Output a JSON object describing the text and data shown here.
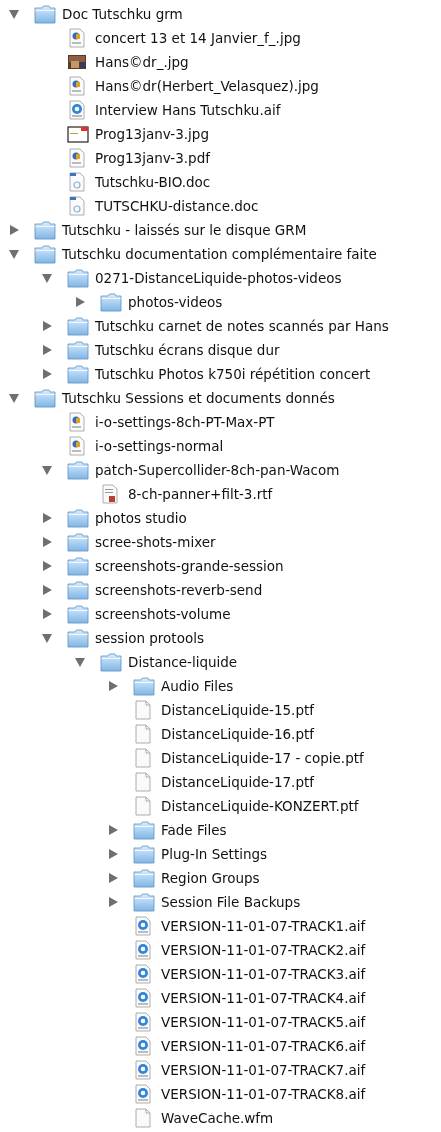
{
  "tree": [
    {
      "name": "Doc Tutschku grm",
      "kind": "folder",
      "expanded": true,
      "children": [
        {
          "name": "concert 13 et 14 Janvier_f_.jpg",
          "kind": "image"
        },
        {
          "name": "Hans©dr_.jpg",
          "kind": "photo"
        },
        {
          "name": "Hans©dr(Herbert_Velasquez).jpg",
          "kind": "image"
        },
        {
          "name": "Interview Hans Tutschku.aif",
          "kind": "audio"
        },
        {
          "name": "Prog13janv-3.jpg",
          "kind": "sheet"
        },
        {
          "name": "Prog13janv-3.pdf",
          "kind": "image"
        },
        {
          "name": "Tutschku-BIO.doc",
          "kind": "document"
        },
        {
          "name": "TUTSCHKU-distance.doc",
          "kind": "document"
        }
      ]
    },
    {
      "name": "Tutschku - laissés sur le disque GRM",
      "kind": "folder",
      "expanded": false
    },
    {
      "name": "Tutschku documentation complémentaire faite",
      "kind": "folder",
      "expanded": true,
      "children": [
        {
          "name": "0271-DistanceLiquide-photos-videos",
          "kind": "folder",
          "expanded": true,
          "children": [
            {
              "name": "photos-videos",
              "kind": "folder",
              "expanded": false
            }
          ]
        },
        {
          "name": "Tutschku carnet de notes scannés par Hans",
          "kind": "folder",
          "expanded": false
        },
        {
          "name": "Tutschku écrans disque dur",
          "kind": "folder",
          "expanded": false
        },
        {
          "name": "Tutschku Photos k750i répétition concert",
          "kind": "folder",
          "expanded": false
        }
      ]
    },
    {
      "name": "Tutschku Sessions et documents donnés",
      "kind": "folder",
      "expanded": true,
      "children": [
        {
          "name": "i-o-settings-8ch-PT-Max-PT",
          "kind": "image"
        },
        {
          "name": "i-o-settings-normal",
          "kind": "image"
        },
        {
          "name": "patch-Supercollider-8ch-pan-Wacom",
          "kind": "folder",
          "expanded": true,
          "children": [
            {
              "name": "8-ch-panner+filt-3.rtf",
              "kind": "rtf"
            }
          ]
        },
        {
          "name": "photos studio",
          "kind": "folder",
          "expanded": false
        },
        {
          "name": "scree-shots-mixer",
          "kind": "folder",
          "expanded": false
        },
        {
          "name": "screenshots-grande-session",
          "kind": "folder",
          "expanded": false
        },
        {
          "name": "screenshots-reverb-send",
          "kind": "folder",
          "expanded": false
        },
        {
          "name": "screenshots-volume",
          "kind": "folder",
          "expanded": false
        },
        {
          "name": "session protools",
          "kind": "folder",
          "expanded": true,
          "children": [
            {
              "name": "Distance-liquide",
              "kind": "folder",
              "expanded": true,
              "children": [
                {
                  "name": "Audio Files",
                  "kind": "folder",
                  "expanded": false
                },
                {
                  "name": "DistanceLiquide-15.ptf",
                  "kind": "blank"
                },
                {
                  "name": "DistanceLiquide-16.ptf",
                  "kind": "blank"
                },
                {
                  "name": "DistanceLiquide-17 - copie.ptf",
                  "kind": "blank"
                },
                {
                  "name": "DistanceLiquide-17.ptf",
                  "kind": "blank"
                },
                {
                  "name": "DistanceLiquide-KONZERT.ptf",
                  "kind": "blank"
                },
                {
                  "name": "Fade Files",
                  "kind": "folder",
                  "expanded": false
                },
                {
                  "name": "Plug-In Settings",
                  "kind": "folder",
                  "expanded": false
                },
                {
                  "name": "Region Groups",
                  "kind": "folder",
                  "expanded": false
                },
                {
                  "name": "Session File Backups",
                  "kind": "folder",
                  "expanded": false
                },
                {
                  "name": "VERSION-11-01-07-TRACK1.aif",
                  "kind": "audio"
                },
                {
                  "name": "VERSION-11-01-07-TRACK2.aif",
                  "kind": "audio"
                },
                {
                  "name": "VERSION-11-01-07-TRACK3.aif",
                  "kind": "audio"
                },
                {
                  "name": "VERSION-11-01-07-TRACK4.aif",
                  "kind": "audio"
                },
                {
                  "name": "VERSION-11-01-07-TRACK5.aif",
                  "kind": "audio"
                },
                {
                  "name": "VERSION-11-01-07-TRACK6.aif",
                  "kind": "audio"
                },
                {
                  "name": "VERSION-11-01-07-TRACK7.aif",
                  "kind": "audio"
                },
                {
                  "name": "VERSION-11-01-07-TRACK8.aif",
                  "kind": "audio"
                },
                {
                  "name": "WaveCache.wfm",
                  "kind": "blank"
                }
              ]
            }
          ]
        }
      ]
    }
  ]
}
